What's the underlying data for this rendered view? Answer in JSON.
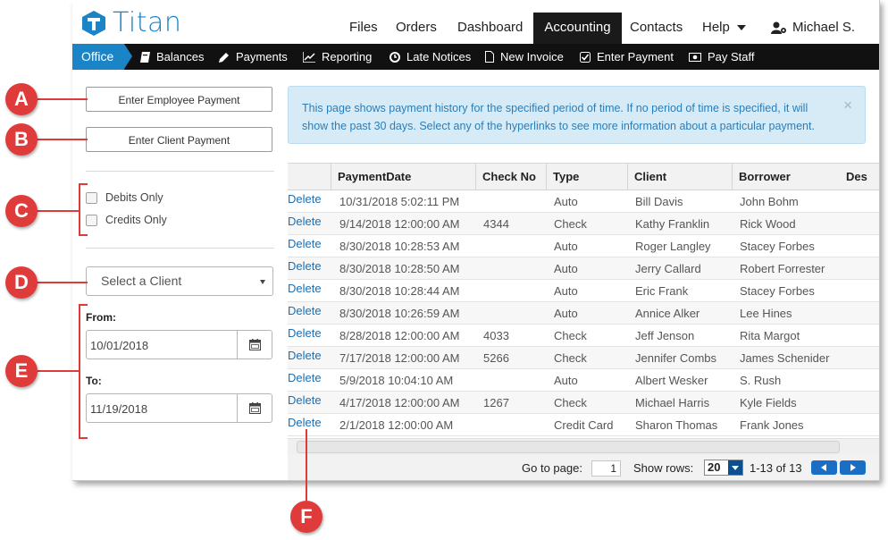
{
  "app": {
    "name": "Titan"
  },
  "nav": {
    "items": [
      {
        "label": "Files"
      },
      {
        "label": "Orders"
      },
      {
        "label": "Dashboard"
      },
      {
        "label": "Accounting",
        "active": true
      },
      {
        "label": "Contacts"
      },
      {
        "label": "Help"
      }
    ],
    "user": "Michael S."
  },
  "subnav": {
    "breadcrumb": "Office",
    "items": [
      {
        "label": "Balances",
        "icon": "book-icon"
      },
      {
        "label": "Payments",
        "icon": "pencil-icon"
      },
      {
        "label": "Reporting",
        "icon": "chart-icon"
      },
      {
        "label": "Late Notices",
        "icon": "clock-icon"
      },
      {
        "label": "New Invoice",
        "icon": "file-icon"
      },
      {
        "label": "Enter Payment",
        "icon": "check-square-icon"
      },
      {
        "label": "Pay Staff",
        "icon": "money-icon"
      }
    ]
  },
  "sidebar": {
    "enter_employee_payment": "Enter Employee Payment",
    "enter_client_payment": "Enter Client Payment",
    "debits_only": "Debits Only",
    "credits_only": "Credits Only",
    "client_select": "Select a Client",
    "from_label": "From:",
    "from_value": "10/01/2018",
    "to_label": "To:",
    "to_value": "11/19/2018"
  },
  "alert": {
    "text": "This page shows payment history for the specified period of time. If no period of time is specified, it will show the past 30 days. Select any of the hyperlinks to see more information about a particular payment.",
    "close": "×"
  },
  "grid": {
    "columns": [
      "PaymentDate",
      "Check No",
      "Type",
      "Client",
      "Borrower",
      "Des"
    ],
    "delete_label": "Delete",
    "rows": [
      [
        "10/31/2018 5:02:11 PM",
        "",
        "Auto",
        "Bill Davis",
        "John Bohm"
      ],
      [
        "9/14/2018 12:00:00 AM",
        "4344",
        "Check",
        "Kathy Franklin",
        "Rick Wood"
      ],
      [
        "8/30/2018 10:28:53 AM",
        "",
        "Auto",
        "Roger Langley",
        "Stacey Forbes"
      ],
      [
        "8/30/2018 10:28:50 AM",
        "",
        "Auto",
        "Jerry Callard",
        "Robert Forrester"
      ],
      [
        "8/30/2018 10:28:44 AM",
        "",
        "Auto",
        "Eric Frank",
        "Stacey Forbes"
      ],
      [
        "8/30/2018 10:26:59 AM",
        "",
        "Auto",
        "Annice Alker",
        "Lee Hines"
      ],
      [
        "8/28/2018 12:00:00 AM",
        "4033",
        "Check",
        "Jeff Jenson",
        "Rita Margot"
      ],
      [
        "7/17/2018 12:00:00 AM",
        "5266",
        "Check",
        "Jennifer Combs",
        "James Schenider"
      ],
      [
        "5/9/2018 10:04:10 AM",
        "",
        "Auto",
        "Albert Wesker",
        "S. Rush"
      ],
      [
        "4/17/2018 12:00:00 AM",
        "1267",
        "Check",
        "Michael Harris",
        "Kyle Fields"
      ],
      [
        "2/1/2018 12:00:00 AM",
        "",
        "Credit Card",
        "Sharon Thomas",
        "Frank Jones"
      ]
    ]
  },
  "pager": {
    "goto_label": "Go to page:",
    "page": "1",
    "show_rows_label": "Show rows:",
    "rows_per_page": "20",
    "range": "1-13 of 13"
  },
  "callouts": [
    "A",
    "B",
    "C",
    "D",
    "E",
    "F"
  ],
  "colors": {
    "brand": "#1a84c7",
    "callout": "#e03b3b",
    "active_nav": "#1a1a1a"
  }
}
